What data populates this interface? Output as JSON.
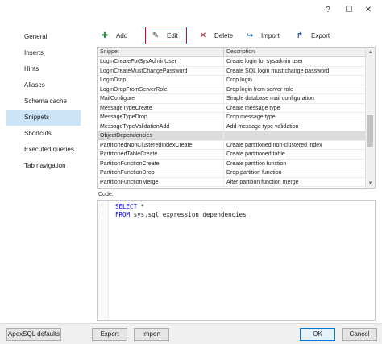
{
  "titlebar": {
    "help": "?",
    "maximize": "☐",
    "close": "✕"
  },
  "sidebar": {
    "items": [
      {
        "label": "General"
      },
      {
        "label": "Inserts"
      },
      {
        "label": "Hints"
      },
      {
        "label": "Aliases"
      },
      {
        "label": "Schema cache"
      },
      {
        "label": "Snippets",
        "active": true
      },
      {
        "label": "Shortcuts"
      },
      {
        "label": "Executed queries"
      },
      {
        "label": "Tab navigation"
      }
    ]
  },
  "toolbar": {
    "add": "Add",
    "edit": "Edit",
    "delete": "Delete",
    "import": "Import",
    "export": "Export"
  },
  "grid": {
    "columns": [
      "Snippet",
      "Description"
    ],
    "rows": [
      [
        "LoginCreateForSysAdminUser",
        "Create login for sysadmin user"
      ],
      [
        "LoginCreateMustChangePassword",
        "Create SQL login must change password"
      ],
      [
        "LoginDrop",
        "Drop login"
      ],
      [
        "LoginDropFromServerRole",
        "Drop login from server role"
      ],
      [
        "MailConfigure",
        "Simple database mail configuration"
      ],
      [
        "MessageTypeCreate",
        "Create message type"
      ],
      [
        "MessageTypeDrop",
        "Drop message type"
      ],
      [
        "MessageTypeValidationAdd",
        "Add message type validation"
      ],
      [
        "ObjectDependencies",
        ""
      ],
      [
        "PartitionedNonClusteredIndexCreate",
        "Create partitioned non-clustered index"
      ],
      [
        "PartitionedTableCreate",
        "Create partitioned table"
      ],
      [
        "PartitionFunctionCreate",
        "Create partition function"
      ],
      [
        "PartitionFunctionDrop",
        "Drop partition function"
      ],
      [
        "PartitionFunctionMerge",
        "Alter partition function merge"
      ]
    ],
    "selected_index": 8
  },
  "code": {
    "label": "Code:",
    "line1_kw": "SELECT",
    "line1_rest": " *",
    "line2_kw": "FROM",
    "line2_rest": " sys.sql_expression_dependencies"
  },
  "bottom": {
    "defaults": "ApexSQL defaults",
    "export": "Export",
    "import": "Import",
    "ok": "OK",
    "cancel": "Cancel"
  }
}
